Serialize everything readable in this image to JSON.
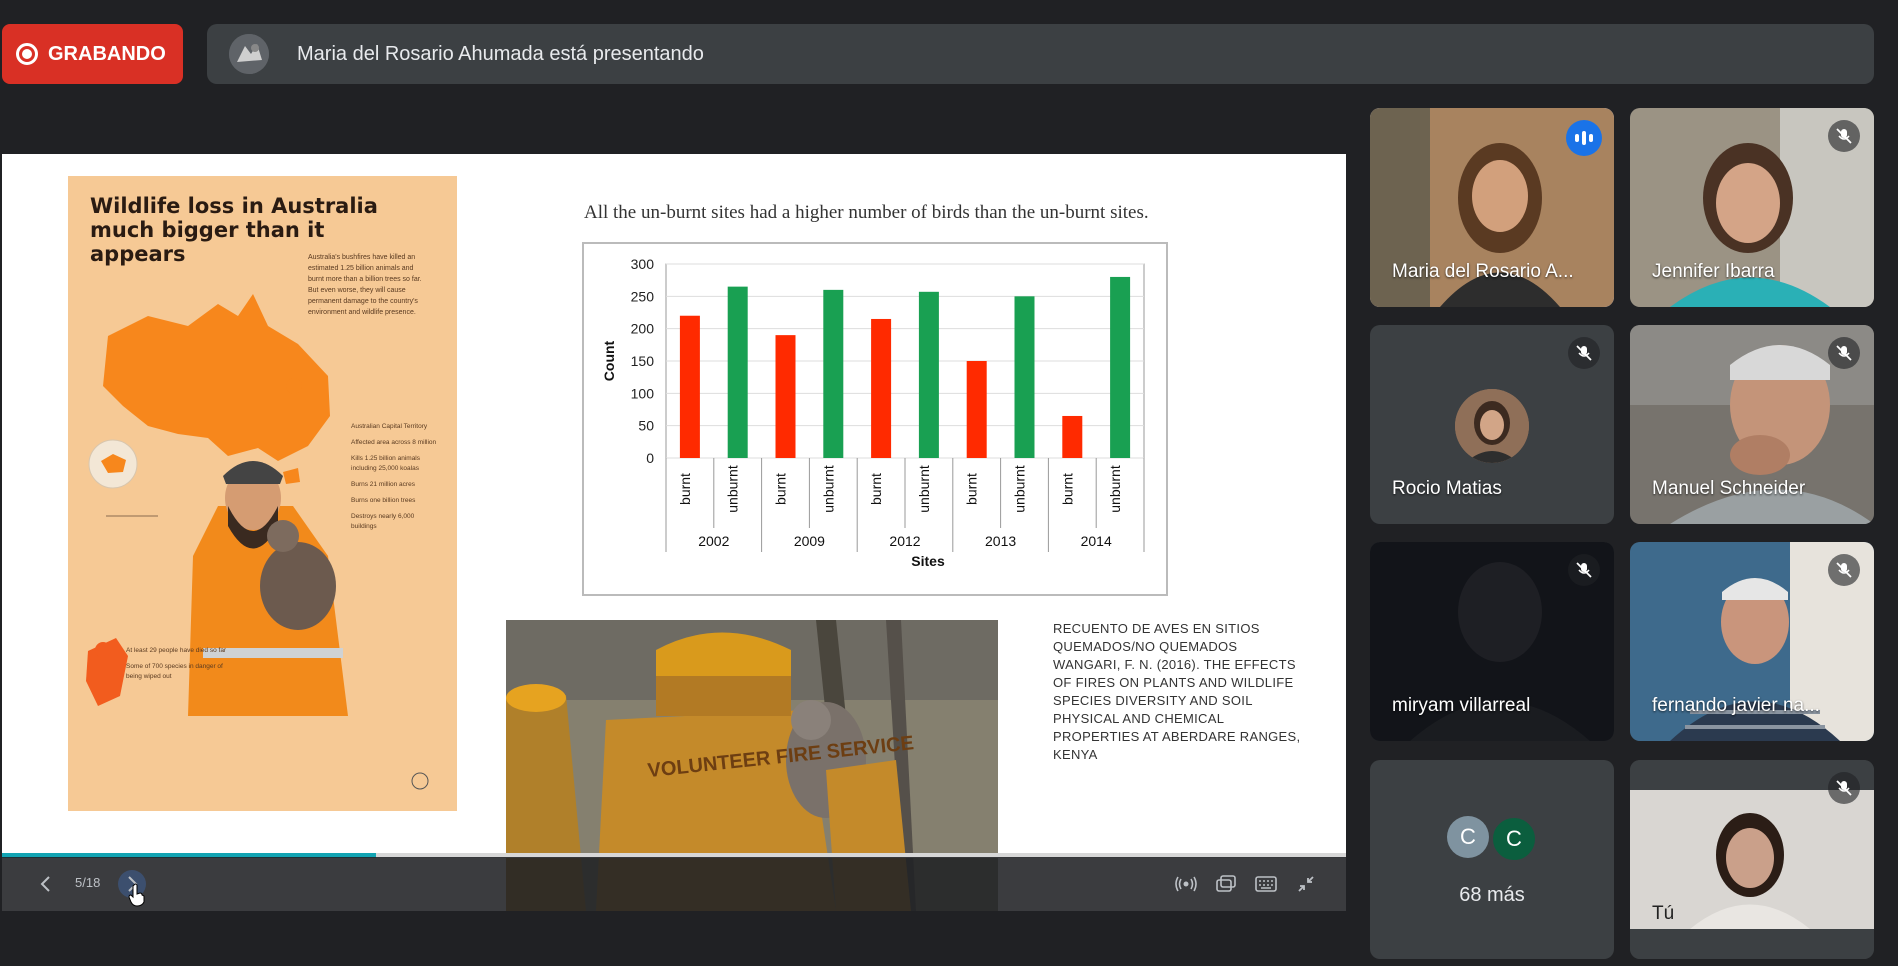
{
  "recording": {
    "label": "GRABANDO",
    "color": "#d93025"
  },
  "presenter_bar": {
    "text": "Maria del Rosario Ahumada está presentando"
  },
  "slide": {
    "poster": {
      "title": "Wildlife loss in Australia much bigger than it appears",
      "blurb": "Australia's bushfires have killed an estimated 1.25 billion animals and burnt more than a billion trees so far. But even worse, they will cause permanent damage to the country's environment and wildlife presence.",
      "stats": [
        "Australian Capital Territory",
        "Affected area across 8 million",
        "Kills 1.25 billion animals including 25,000 koalas",
        "Burns 21 million acres",
        "Burns one billion trees",
        "Destroys nearly 6,000 buildings"
      ],
      "foot": [
        "At least 29 people have died so far",
        "Some of 700 species in danger of being wiped out"
      ]
    },
    "title": "All the un-burnt sites had a higher number of birds than the un-burnt sites.",
    "photo_caption": "VOLUNTEER FIRE SERVICE",
    "reference_lines": [
      "RECUENTO DE AVES EN SITIOS",
      "QUEMADOS/NO QUEMADOS",
      "WANGARI, F. N. (2016). THE EFFECTS",
      "OF FIRES ON PLANTS AND WILDLIFE",
      "SPECIES DIVERSITY AND SOIL",
      "PHYSICAL AND CHEMICAL",
      "PROPERTIES AT ABERDARE RANGES,",
      "KENYA"
    ],
    "progress": 0.278,
    "accent": "#12a4b3"
  },
  "chart_data": {
    "type": "bar",
    "ylabel": "Count",
    "xlabel": "Sites",
    "ylim": [
      0,
      300
    ],
    "yticks": [
      0,
      50,
      100,
      150,
      200,
      250,
      300
    ],
    "groups": [
      "2002",
      "2009",
      "2012",
      "2013",
      "2014"
    ],
    "subcategories": [
      "burnt",
      "unburnt"
    ],
    "series": [
      {
        "name": "burnt",
        "color": "#ff2a00",
        "values": [
          220,
          190,
          215,
          150,
          65
        ]
      },
      {
        "name": "unburnt",
        "color": "#19a052",
        "values": [
          265,
          260,
          257,
          250,
          280
        ]
      }
    ],
    "grid": true,
    "legend": "none"
  },
  "controls": {
    "pager": "5/18"
  },
  "participants": [
    {
      "name": "Maria del Rosario A...",
      "speaking": true,
      "bg": "#9b7656"
    },
    {
      "name": "Jennifer Ibarra",
      "muted": true,
      "bg": "#8f8475"
    },
    {
      "name": "Rocio Matias",
      "muted": true,
      "bg": "#3c4043"
    },
    {
      "name": "Manuel Schneider",
      "muted": true,
      "bg": "#7e7c78"
    },
    {
      "name": "miryam villarreal",
      "muted": true,
      "bg": "#14161a"
    },
    {
      "name": "fernando javier na...",
      "muted": true,
      "bg": "#4a6a88"
    },
    {
      "name": "Tú",
      "muted": true,
      "bg": "#b9b3ad"
    }
  ],
  "more": {
    "label": "68 más",
    "avatars": [
      {
        "letter": "C",
        "color": "#7f93a0"
      },
      {
        "letter": "C",
        "color": "#0b5e3e"
      }
    ]
  }
}
